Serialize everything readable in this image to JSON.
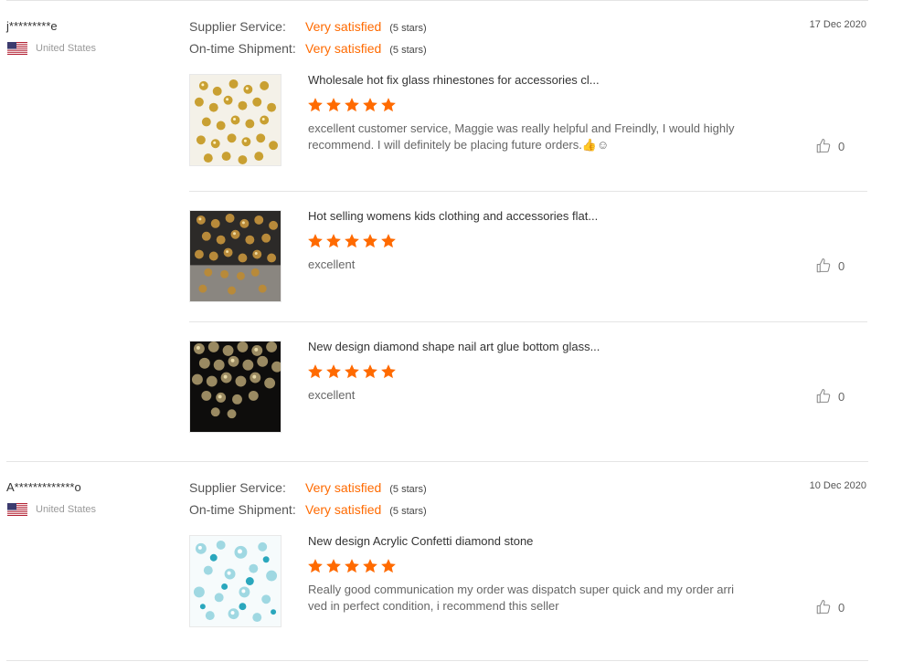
{
  "reviews": [
    {
      "buyer": "j*********e",
      "country": "United States",
      "date": "17 Dec 2020",
      "ratings": [
        {
          "label": "Supplier Service:",
          "value": "Very satisfied",
          "stars": "(5 stars)"
        },
        {
          "label": "On-time Shipment:",
          "value": "Very satisfied",
          "stars": "(5 stars)"
        }
      ],
      "items": [
        {
          "title": "Wholesale hot fix glass rhinestones for accessories cl...",
          "rating": 5,
          "comment_lines": [
            "excellent customer service, Maggie was really helpful and Freindly, I would highly",
            "recommend. I will definitely be placing future orders.👍☺"
          ],
          "likes": "0",
          "image_icon": "gold-rhinestones-light"
        },
        {
          "title": "Hot selling womens kids clothing and accessories flat...",
          "rating": 5,
          "comment_lines": [
            "excellent"
          ],
          "likes": "0",
          "image_icon": "gold-rhinestones-dark"
        },
        {
          "title": "New design diamond shape nail art glue bottom glass...",
          "rating": 5,
          "comment_lines": [
            "excellent"
          ],
          "likes": "0",
          "image_icon": "gold-rhinestones-black"
        }
      ]
    },
    {
      "buyer": "A*************o",
      "country": "United States",
      "date": "10 Dec 2020",
      "ratings": [
        {
          "label": "Supplier Service:",
          "value": "Very satisfied",
          "stars": "(5 stars)"
        },
        {
          "label": "On-time Shipment:",
          "value": "Very satisfied",
          "stars": "(5 stars)"
        }
      ],
      "items": [
        {
          "title": "New design Acrylic Confetti diamond stone",
          "rating": 5,
          "comment_lines": [
            "Really good communication my order was dispatch super quick and my order arri",
            "ved in perfect condition,  i recommend this seller"
          ],
          "likes": "0",
          "image_icon": "blue-confetti-stones"
        }
      ]
    }
  ],
  "colors": {
    "accent": "#ff6a00",
    "divider": "#e4e4e4",
    "muted": "#999999"
  },
  "icons": {
    "flag": "us-flag-icon",
    "star": "star-icon",
    "like": "thumbs-up-icon"
  }
}
